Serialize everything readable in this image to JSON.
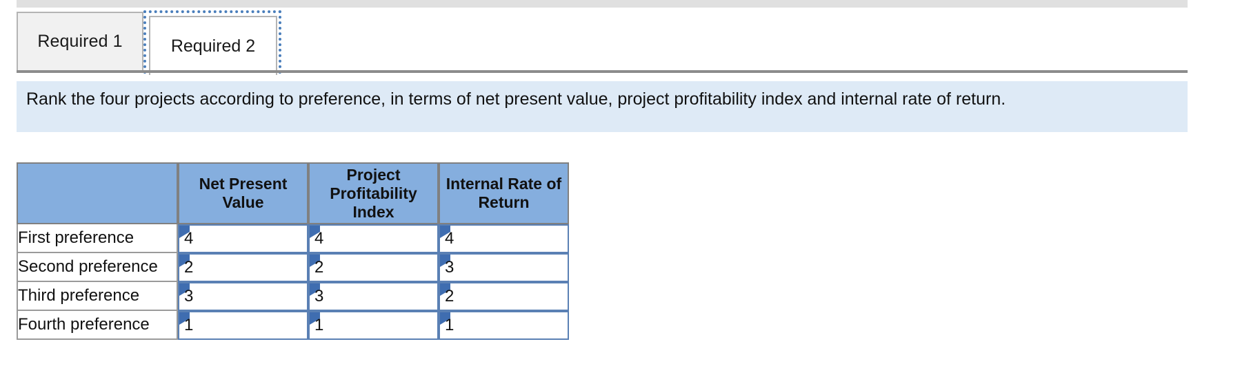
{
  "tabs": [
    {
      "label": "Required 1",
      "active": false
    },
    {
      "label": "Required 2",
      "active": true
    }
  ],
  "instruction": {
    "text": "Rank the four projects according to preference, in terms of net present value, project profitability index and internal rate of return."
  },
  "table": {
    "corner_header": "",
    "column_headers": [
      "Net Present Value",
      "Project Profitability Index",
      "Internal Rate of Return"
    ],
    "rows": [
      {
        "label": "First preference",
        "values": [
          "4",
          "4",
          "4"
        ]
      },
      {
        "label": "Second preference",
        "values": [
          "2",
          "2",
          "3"
        ]
      },
      {
        "label": "Third preference",
        "values": [
          "3",
          "3",
          "2"
        ]
      },
      {
        "label": "Fourth preference",
        "values": [
          "1",
          "1",
          "1"
        ]
      }
    ]
  },
  "colors": {
    "header_blue": "#85aede",
    "panel_blue": "#deeaf6",
    "input_border": "#5a80b4",
    "flag_blue": "#3f6db0",
    "focus_outline": "#4a7ebb",
    "band_gray": "#e0e0e0",
    "rule_gray": "#8c8c8c"
  }
}
